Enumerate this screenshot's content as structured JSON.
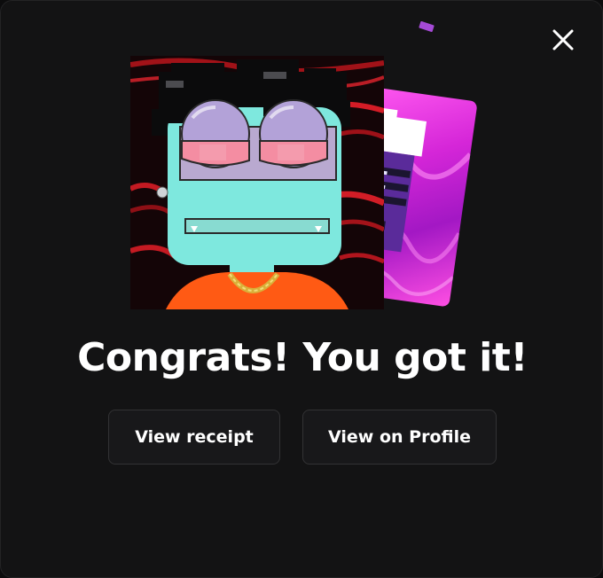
{
  "dialog": {
    "heading": "Congrats! You got it!",
    "close_icon": "close-icon"
  },
  "nft": {
    "main_art": "pixel-character-nft",
    "back_card_art": "pink-nft-card"
  },
  "actions": {
    "view_receipt_label": "View receipt",
    "view_profile_label": "View on Profile"
  },
  "colors": {
    "background": "#131314",
    "button_bg": "#18181a",
    "button_border": "#323234",
    "text": "#ffffff",
    "accent_pink": "#e03ae0",
    "face_teal": "#7ee8de",
    "shirt_orange": "#ff5a14"
  }
}
